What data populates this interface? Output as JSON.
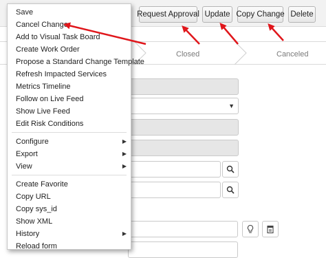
{
  "toolbar": {
    "buttons": [
      {
        "label": "Request Approval"
      },
      {
        "label": "Update"
      },
      {
        "label": "Copy Change"
      },
      {
        "label": "Delete"
      }
    ]
  },
  "process_flow": {
    "stages": [
      {
        "label": "Closed"
      },
      {
        "label": "Canceled"
      }
    ]
  },
  "context_menu": {
    "groups": [
      {
        "items": [
          {
            "label": "Save"
          },
          {
            "label": "Cancel Change"
          },
          {
            "label": "Add to Visual Task Board"
          },
          {
            "label": "Create Work Order"
          },
          {
            "label": "Propose a Standard Change Template"
          },
          {
            "label": "Refresh Impacted Services"
          },
          {
            "label": "Metrics Timeline"
          },
          {
            "label": "Follow on Live Feed"
          },
          {
            "label": "Show Live Feed"
          },
          {
            "label": "Edit Risk Conditions"
          }
        ]
      },
      {
        "items": [
          {
            "label": "Configure",
            "submenu": true
          },
          {
            "label": "Export",
            "submenu": true
          },
          {
            "label": "View",
            "submenu": true
          }
        ]
      },
      {
        "items": [
          {
            "label": "Create Favorite"
          },
          {
            "label": "Copy URL"
          },
          {
            "label": "Copy sys_id"
          },
          {
            "label": "Show XML"
          },
          {
            "label": "History",
            "submenu": true
          },
          {
            "label": "Reload form"
          }
        ]
      }
    ]
  },
  "icons": {
    "submenu_arrow": "caret-right-icon",
    "select_arrow": "caret-down-icon",
    "lookup": "search-icon",
    "suggestion": "lightbulb-icon",
    "template": "template-icon"
  },
  "colors": {
    "annotation_arrow": "#e0161b",
    "readonly_field": "#e6e6e6",
    "toolbar_bg": "#f2f2f2"
  }
}
